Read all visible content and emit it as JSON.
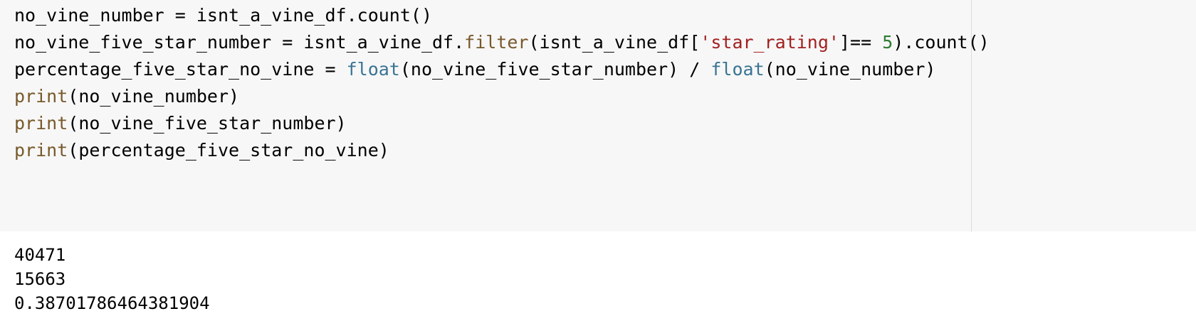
{
  "code": {
    "line1": {
      "a": "no_vine_number = isnt_a_vine_df.count()"
    },
    "line2": {
      "a": "no_vine_five_star_number = isnt_a_vine_df.",
      "filter": "filter",
      "b": "(isnt_a_vine_df[",
      "str": "'star_rating'",
      "c": "]== ",
      "num": "5",
      "d": ").count()"
    },
    "line3": {
      "a": "percentage_five_star_no_vine = ",
      "float1": "float",
      "b": "(no_vine_five_star_number) / ",
      "float2": "float",
      "c": "(no_vine_number)"
    },
    "line4": {
      "fn": "print",
      "arg": "(no_vine_number)"
    },
    "line5": {
      "fn": "print",
      "arg": "(no_vine_five_star_number)"
    },
    "line6": {
      "fn": "print",
      "arg": "(percentage_five_star_no_vine)"
    }
  },
  "output": {
    "lines": [
      "40471",
      "15663",
      "0.38701786464381904"
    ]
  },
  "colors": {
    "builtin": "#78592a",
    "type": "#3a7493",
    "string": "#a2201f",
    "number": "#2e7d32",
    "cell_background": "#f7f7f7"
  }
}
